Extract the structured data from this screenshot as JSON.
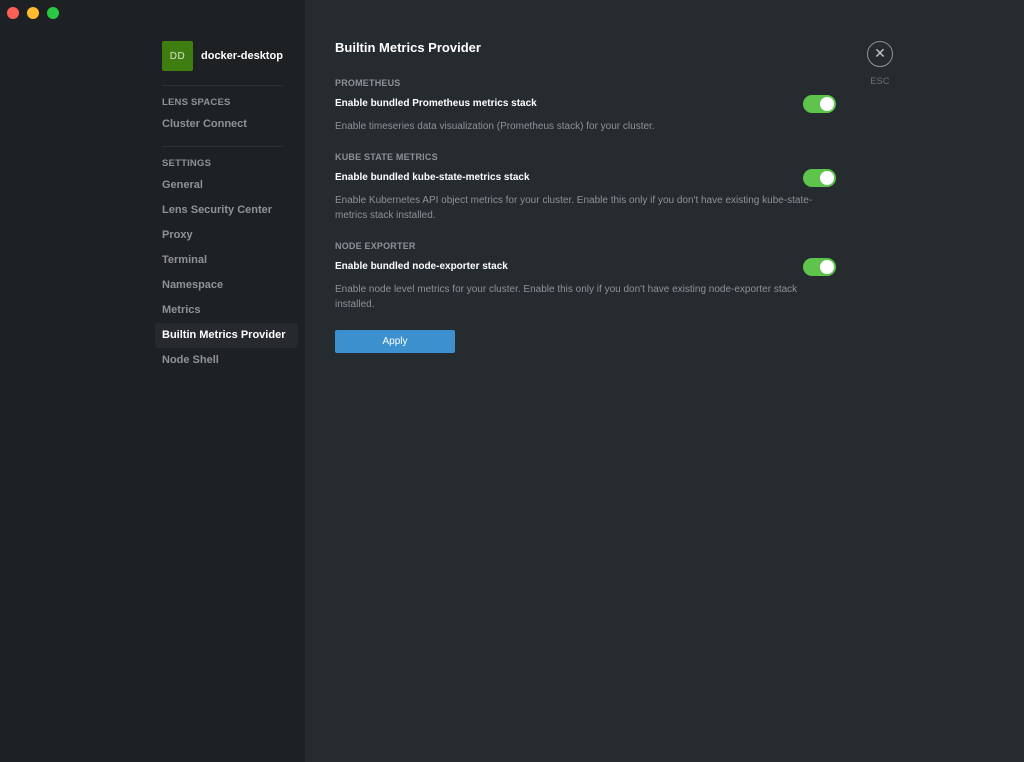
{
  "cluster": {
    "avatar_initials": "DD",
    "avatar_color": "#3e7d10",
    "name": "docker-desktop"
  },
  "sidebar": {
    "sections": [
      {
        "title": "LENS SPACES",
        "items": [
          {
            "label": "Cluster Connect",
            "active": false
          }
        ]
      },
      {
        "title": "SETTINGS",
        "items": [
          {
            "label": "General",
            "active": false
          },
          {
            "label": "Lens Security Center",
            "active": false
          },
          {
            "label": "Proxy",
            "active": false
          },
          {
            "label": "Terminal",
            "active": false
          },
          {
            "label": "Namespace",
            "active": false
          },
          {
            "label": "Metrics",
            "active": false
          },
          {
            "label": "Builtin Metrics Provider",
            "active": true
          },
          {
            "label": "Node Shell",
            "active": false
          }
        ]
      }
    ]
  },
  "main": {
    "title": "Builtin Metrics Provider",
    "close_icon": "close-icon",
    "esc_label": "ESC",
    "groups": [
      {
        "title": "PROMETHEUS",
        "label": "Enable bundled Prometheus metrics stack",
        "enabled": true,
        "description": "Enable timeseries data visualization (Prometheus stack) for your cluster."
      },
      {
        "title": "KUBE STATE METRICS",
        "label": "Enable bundled kube-state-metrics stack",
        "enabled": true,
        "description": "Enable Kubernetes API object metrics for your cluster. Enable this only if you don't have existing kube-state-metrics stack installed."
      },
      {
        "title": "NODE EXPORTER",
        "label": "Enable bundled node-exporter stack",
        "enabled": true,
        "description": "Enable node level metrics for your cluster. Enable this only if you don't have existing node-exporter stack installed."
      }
    ],
    "apply_label": "Apply"
  },
  "colors": {
    "sidebar_bg": "#1e2124",
    "content_bg": "#262b30",
    "toggle_on": "#5ec44c",
    "accent_button": "#3d90ce"
  }
}
